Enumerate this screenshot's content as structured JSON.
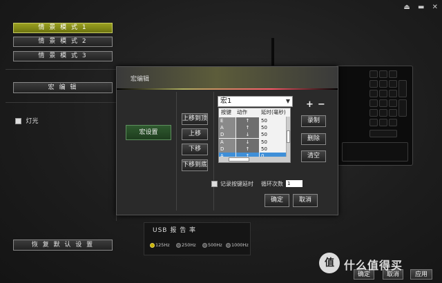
{
  "top_icons": [
    "eject-icon",
    "minimize-icon",
    "close-icon"
  ],
  "modes": [
    {
      "label": "情 景 模 式 1",
      "active": true
    },
    {
      "label": "情 景 模 式 2",
      "active": false
    },
    {
      "label": "情 景 模 式 3",
      "active": false
    }
  ],
  "sidebar": {
    "macro_edit_label": "宏 编 辑",
    "light_label": "灯光",
    "restore_label": "恢 复 默 认 设 置"
  },
  "usb": {
    "title": "USB 报 告 率",
    "options": [
      "125Hz",
      "250Hz",
      "500Hz",
      "1000Hz"
    ],
    "selected": "125Hz"
  },
  "footer": {
    "ok_label": "确定",
    "cancel_label": "取消",
    "apply_label": "应用"
  },
  "watermark": {
    "logo": "值",
    "text": "什么值得买"
  },
  "macro_dialog": {
    "title": "宏编辑",
    "set_button": "宏设置",
    "move_buttons": [
      "上移到顶",
      "上移",
      "下移",
      "下移到底"
    ],
    "macro_select": "宏1",
    "plus": "+",
    "minus": "−",
    "table": {
      "headers": [
        "按键",
        "动作",
        "延时(毫秒)"
      ],
      "rows": [
        {
          "key": "E",
          "action": "↑",
          "delay": "50",
          "selected": false
        },
        {
          "key": "A",
          "action": "↑",
          "delay": "50",
          "selected": false
        },
        {
          "key": "D",
          "action": "↓",
          "delay": "50",
          "selected": false
        },
        {
          "key": "A",
          "action": "↓",
          "delay": "50",
          "selected": false
        },
        {
          "key": "D",
          "action": "↑",
          "delay": "50",
          "selected": false
        },
        {
          "key": "A",
          "action": "↑",
          "delay": "0",
          "selected": true
        }
      ]
    },
    "action_buttons": [
      "录制",
      "删除",
      "清空"
    ],
    "record_delay_label": "记录按键延时",
    "loop_label": "循环次数",
    "loop_value": "1",
    "ok_label": "确定",
    "cancel_label": "取消"
  }
}
